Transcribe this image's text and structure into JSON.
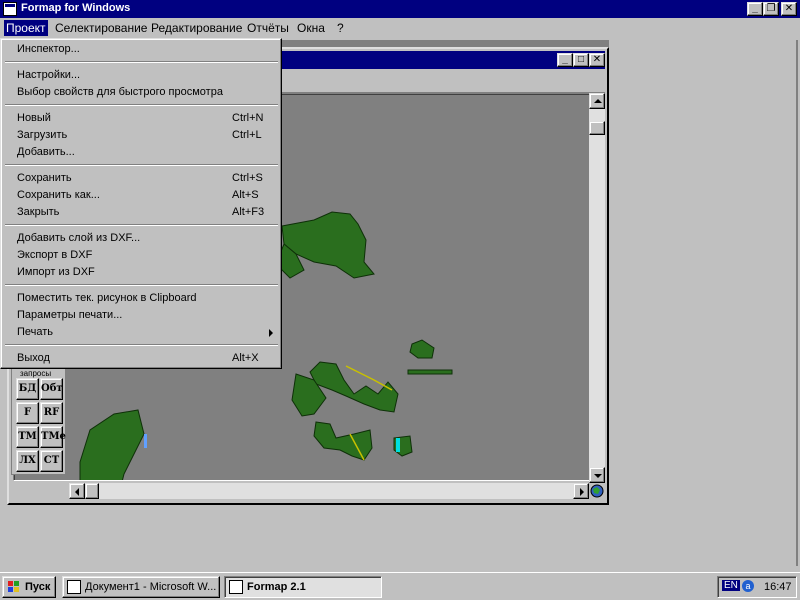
{
  "app": {
    "title": "Formap for Windows"
  },
  "menubar": [
    "Проект",
    "Селектирование",
    "Редактирование",
    "Отчёты",
    "Окна",
    "?"
  ],
  "dropdown": {
    "items": [
      {
        "label": "Инспектор...",
        "shortcut": ""
      },
      {
        "label": "Настройки...",
        "shortcut": ""
      },
      {
        "label": "Выбор свойств для быстрого просмотра",
        "shortcut": ""
      },
      {
        "label": "Новый",
        "shortcut": "Ctrl+N"
      },
      {
        "label": "Загрузить",
        "shortcut": "Ctrl+L"
      },
      {
        "label": "Добавить...",
        "shortcut": ""
      },
      {
        "label": "Сохранить",
        "shortcut": "Ctrl+S"
      },
      {
        "label": "Сохранить как...",
        "shortcut": "Alt+S"
      },
      {
        "label": "Закрыть",
        "shortcut": "Alt+F3"
      },
      {
        "label": "Добавить слой из DXF...",
        "shortcut": ""
      },
      {
        "label": "Экспорт в DXF",
        "shortcut": ""
      },
      {
        "label": "Импорт из DXF",
        "shortcut": ""
      },
      {
        "label": "Поместить тек. рисунок в Clipboard",
        "shortcut": ""
      },
      {
        "label": "Параметры печати...",
        "shortcut": ""
      },
      {
        "label": "Печать",
        "shortcut": ""
      },
      {
        "label": "Выход",
        "shortcut": "Alt+X"
      }
    ]
  },
  "query_panel": {
    "caption": "запросы",
    "buttons": [
      "БД",
      "Обт",
      "F",
      "RF",
      "ТМ",
      "ТМе",
      "ЛХ",
      "СТ"
    ]
  },
  "taskbar": {
    "start_label": "Пуск",
    "tasks": [
      "Документ1 - Microsoft W...",
      "Formap 2.1"
    ],
    "lang": "EN",
    "clock": "16:47"
  },
  "colors": {
    "titlebar": "#000080",
    "map_bg": "#808080",
    "parcel_green": "#2a6e1e"
  }
}
